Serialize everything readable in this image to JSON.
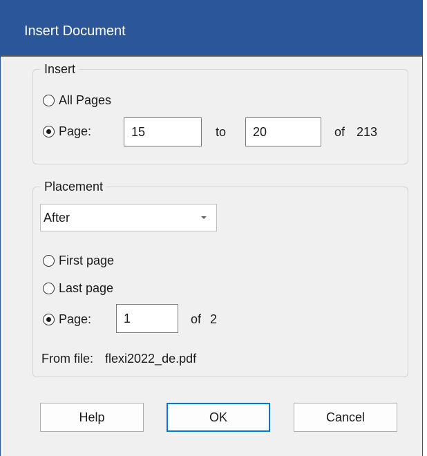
{
  "window": {
    "title": "Insert Document"
  },
  "insert": {
    "legend": "Insert",
    "all_pages_label": "All Pages",
    "page_label": "Page:",
    "from_value": "15",
    "to_label": "to",
    "to_value": "20",
    "of_label": "of",
    "total_pages": "213",
    "selected": "page"
  },
  "placement": {
    "legend": "Placement",
    "position_value": "After",
    "first_page_label": "First page",
    "last_page_label": "Last page",
    "page_label": "Page:",
    "page_value": "1",
    "of_label": "of",
    "total_pages": "2",
    "selected": "page",
    "from_file_label": "From file:",
    "from_file_value": "flexi2022_de.pdf"
  },
  "buttons": {
    "help": "Help",
    "ok": "OK",
    "cancel": "Cancel"
  },
  "colors": {
    "titlebar": "#2b579a",
    "default_button_border": "#0078d7"
  }
}
